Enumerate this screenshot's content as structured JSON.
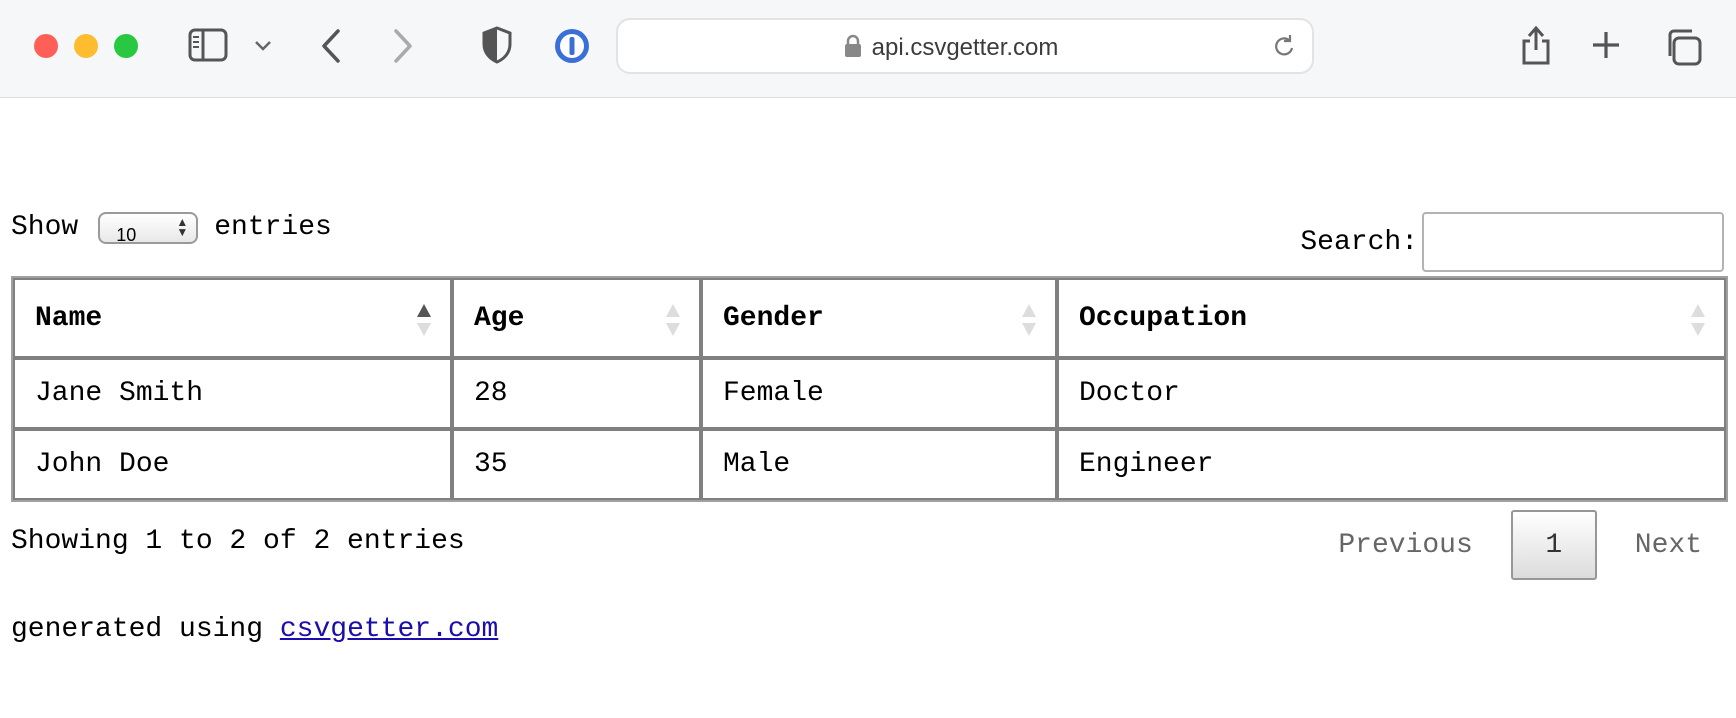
{
  "browser": {
    "url": "api.csvgetter.com",
    "colors": {
      "close": "#fe5f57",
      "minimize": "#febc2e",
      "zoom": "#28c840"
    },
    "icons": [
      "sidebar-icon",
      "chevron-down-icon",
      "back-icon",
      "forward-icon",
      "shield-icon",
      "password-manager-icon",
      "lock-icon",
      "reload-icon",
      "share-icon",
      "new-tab-icon",
      "tabs-overview-icon"
    ]
  },
  "length": {
    "label_show": "Show",
    "value": "10",
    "label_entries": "entries"
  },
  "search": {
    "label": "Search:",
    "value": ""
  },
  "table": {
    "headers": [
      "Name",
      "Age",
      "Gender",
      "Occupation"
    ],
    "sorted_column": "Name",
    "sort_direction": "ascending",
    "rows": [
      [
        "Jane Smith",
        "28",
        "Female",
        "Doctor"
      ],
      [
        "John Doe",
        "35",
        "Male",
        "Engineer"
      ]
    ]
  },
  "info": "Showing 1 to 2 of 2 entries",
  "pagination": {
    "previous": "Previous",
    "current": "1",
    "next": "Next"
  },
  "footer": {
    "text": "generated using",
    "link": "csvgetter.com"
  }
}
